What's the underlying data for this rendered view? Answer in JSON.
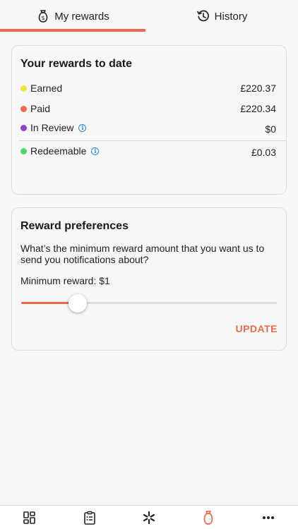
{
  "tabs": [
    {
      "label": "My rewards",
      "icon": "money-bag-icon",
      "active": true
    },
    {
      "label": "History",
      "icon": "history-icon",
      "active": false
    }
  ],
  "colors": {
    "accent": "#ee6a4b",
    "earned": "#f5e43a",
    "paid": "#ee6a4b",
    "in_review": "#8e44c6",
    "redeemable": "#4cd964",
    "info": "#2f86d6"
  },
  "rewards": {
    "title": "Your rewards to date",
    "rows": [
      {
        "label": "Earned",
        "value": "£220.37",
        "dot": "earned",
        "info": false
      },
      {
        "label": "Paid",
        "value": "£220.34",
        "dot": "paid",
        "info": false
      },
      {
        "label": "In Review",
        "value": "$0",
        "dot": "in_review",
        "info": true
      },
      {
        "label": "Redeemable",
        "value": "£0.03",
        "dot": "redeemable",
        "info": true
      }
    ]
  },
  "preferences": {
    "title": "Reward preferences",
    "question": "What’s the minimum reward amount that you want us to send you notifications about?",
    "minimum_label": "Minimum reward: $1",
    "slider_fraction": 0.22,
    "update_label": "UPDATE"
  },
  "bottom_nav": [
    {
      "icon": "dashboard-icon",
      "active": false
    },
    {
      "icon": "clipboard-list-icon",
      "active": false
    },
    {
      "icon": "walmart-spark-icon",
      "active": false
    },
    {
      "icon": "money-bag-icon",
      "active": true
    },
    {
      "icon": "more-icon",
      "active": false
    }
  ]
}
